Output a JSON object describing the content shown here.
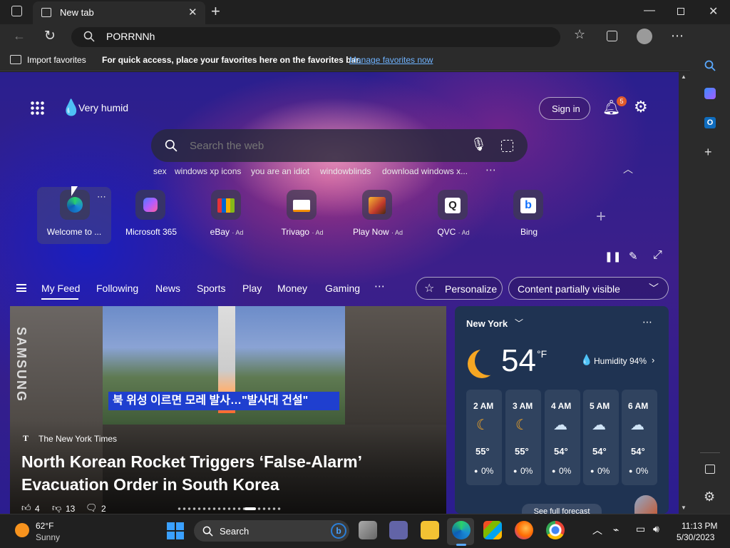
{
  "browser": {
    "tab_title": "New tab",
    "address_value": "PORRNNh",
    "favbar": {
      "import_label": "Import favorites",
      "message": "For quick access, place your favorites here on the favorites bar.",
      "manage_link": "Manage favorites now"
    }
  },
  "header": {
    "weather_note": "Very humid",
    "signin_label": "Sign in",
    "notification_count": "5"
  },
  "search": {
    "placeholder": "Search the web",
    "suggestions": [
      "sex",
      "windows xp icons",
      "you are an idiot",
      "windowblinds",
      "download windows x..."
    ]
  },
  "quicklinks": [
    {
      "label": "Welcome to ...",
      "ad": ""
    },
    {
      "label": "Microsoft 365",
      "ad": ""
    },
    {
      "label": "eBay",
      "ad": "· Ad"
    },
    {
      "label": "Trivago",
      "ad": "· Ad"
    },
    {
      "label": "Play Now",
      "ad": "· Ad"
    },
    {
      "label": "QVC",
      "ad": "· Ad"
    },
    {
      "label": "Bing",
      "ad": ""
    }
  ],
  "feed": {
    "tabs": [
      "My Feed",
      "Following",
      "News",
      "Sports",
      "Play",
      "Money",
      "Gaming"
    ],
    "personalize_label": "Personalize",
    "visibility_label": "Content partially visible"
  },
  "article": {
    "source": "The New York Times",
    "headline_1": "North Korean Rocket Triggers ‘False-Alarm’",
    "headline_2": "Evacuation Order in South Korea",
    "likes": "4",
    "dislikes": "13",
    "comments": "2",
    "image_caption": "북 위성 이르면 모레 발사…\"발사대 건설\"",
    "image_side_text": "SAMSUNG"
  },
  "weather": {
    "city": "New York",
    "temp": "54",
    "unit": "°F",
    "humidity": "Humidity 94%",
    "hours": [
      {
        "time": "2 AM",
        "temp": "55°",
        "precip": "0%",
        "icon": "moon-icon"
      },
      {
        "time": "3 AM",
        "temp": "55°",
        "precip": "0%",
        "icon": "moon-icon"
      },
      {
        "time": "4 AM",
        "temp": "54°",
        "precip": "0%",
        "icon": "moon-cloud-icon"
      },
      {
        "time": "5 AM",
        "temp": "54°",
        "precip": "0%",
        "icon": "moon-cloud-icon"
      },
      {
        "time": "6 AM",
        "temp": "54°",
        "precip": "0%",
        "icon": "cloud-icon"
      }
    ],
    "forecast_link": "See full forecast"
  },
  "taskbar": {
    "weather_temp": "62°F",
    "weather_desc": "Sunny",
    "search_label": "Search",
    "time": "11:13 PM",
    "date": "5/30/2023"
  }
}
